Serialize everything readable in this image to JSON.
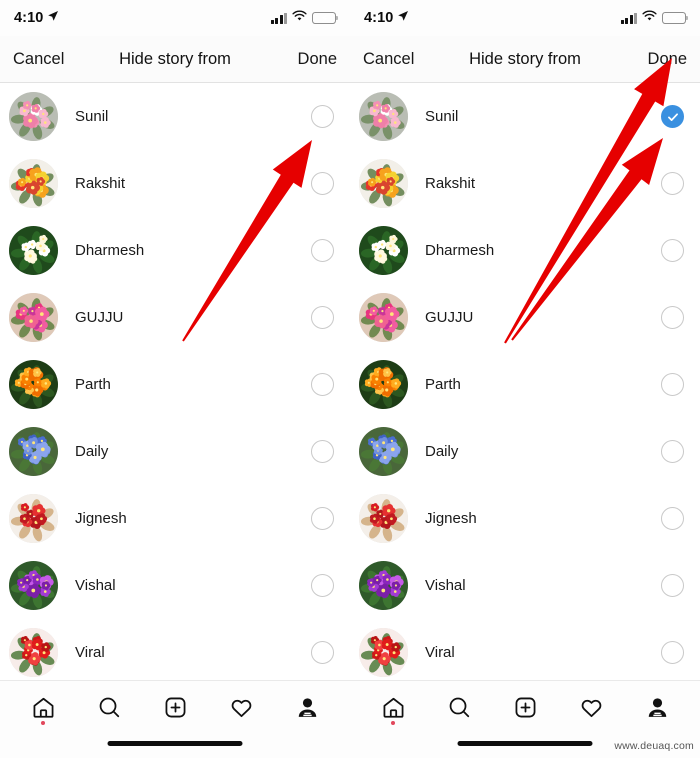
{
  "status_bar": {
    "time": "4:10",
    "location_icon": "location-arrow-icon",
    "signal_icon": "cellular-signal-icon",
    "wifi_icon": "wifi-icon",
    "battery_icon": "battery-charging-icon",
    "battery_charging": true
  },
  "header": {
    "cancel_label": "Cancel",
    "title": "Hide story from",
    "done_label": "Done"
  },
  "contacts": [
    {
      "name": "Sunil",
      "avatar": "pink-bouquet",
      "selected_left": false,
      "selected_right": true
    },
    {
      "name": "Rakshit",
      "avatar": "mixed-roses",
      "selected_left": false,
      "selected_right": false
    },
    {
      "name": "Dharmesh",
      "avatar": "white-plumeria",
      "selected_left": false,
      "selected_right": false
    },
    {
      "name": "GUJJU",
      "avatar": "pink-zinnia",
      "selected_left": false,
      "selected_right": false
    },
    {
      "name": "Parth",
      "avatar": "orange-gazania",
      "selected_left": false,
      "selected_right": false
    },
    {
      "name": "Daily",
      "avatar": "blue-hydrangea",
      "selected_left": false,
      "selected_right": false
    },
    {
      "name": "Jignesh",
      "avatar": "teddy-red-roses",
      "selected_left": false,
      "selected_right": false
    },
    {
      "name": "Vishal",
      "avatar": "purple-lilac",
      "selected_left": false,
      "selected_right": false
    },
    {
      "name": "Viral",
      "avatar": "red-rose-bunch",
      "selected_left": false,
      "selected_right": false
    }
  ],
  "tabbar": {
    "items": [
      {
        "icon": "home-icon",
        "badge_dot": true
      },
      {
        "icon": "search-icon",
        "badge_dot": false
      },
      {
        "icon": "add-post-icon",
        "badge_dot": false
      },
      {
        "icon": "heart-icon",
        "badge_dot": false
      },
      {
        "icon": "profile-icon",
        "badge_dot": false
      }
    ],
    "home_indicator": "home-indicator"
  },
  "annotations": {
    "arrow_color": "#e60000",
    "arrows": [
      {
        "target": "left-panel-sunil-checkbox"
      },
      {
        "target": "right-panel-done-button"
      },
      {
        "target": "right-panel-sunil-checkbox-selected"
      }
    ]
  },
  "watermark": "www.deuaq.com",
  "colors": {
    "accent_blue": "#3a90e0",
    "arrow_red": "#e60000",
    "battery_green": "#30d158",
    "badge_red": "#e1485c"
  }
}
